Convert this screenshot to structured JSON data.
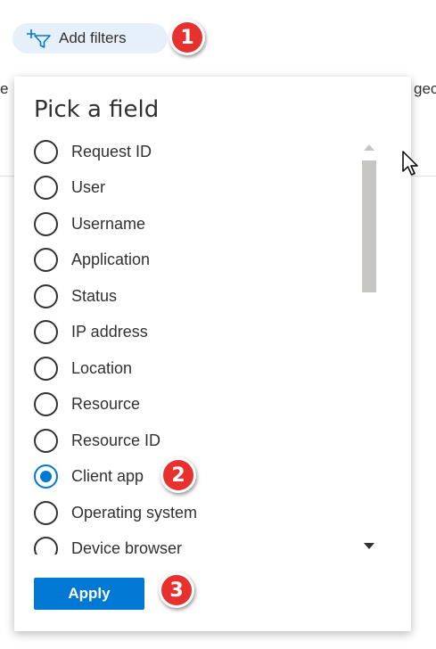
{
  "header": {
    "add_filters_label": "Add filters",
    "filter_icon": "add-filter-icon"
  },
  "background": {
    "left_fragment": "e",
    "right_fragment": "gec"
  },
  "callouts": [
    "1",
    "2",
    "3"
  ],
  "panel": {
    "title": "Pick a field",
    "selected": "Client app",
    "options": [
      {
        "label": "Request ID",
        "checked": false
      },
      {
        "label": "User",
        "checked": false
      },
      {
        "label": "Username",
        "checked": false
      },
      {
        "label": "Application",
        "checked": false
      },
      {
        "label": "Status",
        "checked": false
      },
      {
        "label": "IP address",
        "checked": false
      },
      {
        "label": "Location",
        "checked": false
      },
      {
        "label": "Resource",
        "checked": false
      },
      {
        "label": "Resource ID",
        "checked": false
      },
      {
        "label": "Client app",
        "checked": true
      },
      {
        "label": "Operating system",
        "checked": false
      },
      {
        "label": "Device browser",
        "checked": false
      }
    ],
    "apply_label": "Apply"
  },
  "colors": {
    "accent": "#0078d4",
    "callout": "#e8312f",
    "pill_bg": "#e6f0fa"
  }
}
